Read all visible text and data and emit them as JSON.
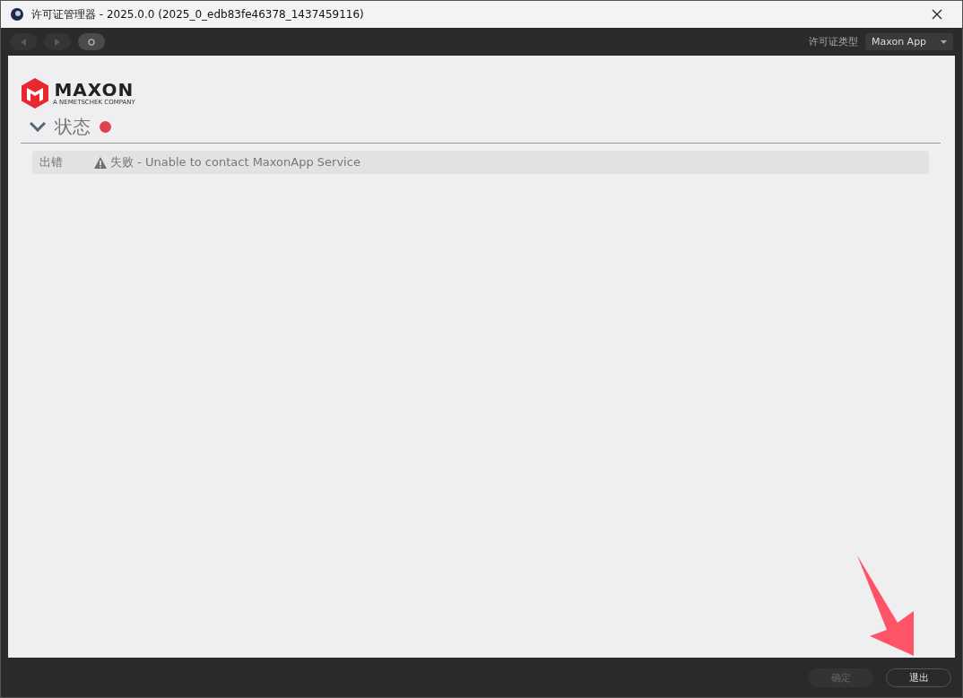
{
  "window": {
    "title": "许可证管理器 - 2025.0.0 (2025_0_edb83fe46378_1437459116)"
  },
  "toolbar": {
    "nav": [
      {
        "kind": "back",
        "disabled": true
      },
      {
        "kind": "forward",
        "disabled": true
      },
      {
        "kind": "refresh",
        "disabled": false
      }
    ],
    "license_label": "许可证类型",
    "license_value": "Maxon App"
  },
  "logo": {
    "name": "MAXON",
    "tagline": "A NEMETSCHEK COMPANY"
  },
  "section": {
    "title": "状态",
    "expanded": true,
    "error": true
  },
  "rows": [
    {
      "label": "出错",
      "message": "失败 - Unable to contact MaxonApp Service"
    }
  ],
  "buttons": [
    {
      "label": "确定",
      "disabled": true
    },
    {
      "label": "退出",
      "disabled": false
    }
  ]
}
